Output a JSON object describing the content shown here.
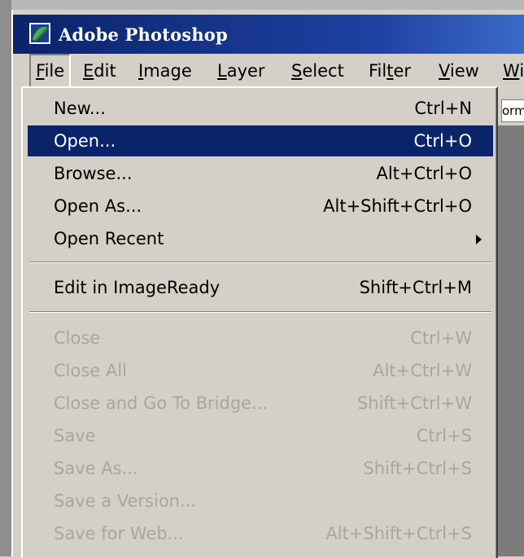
{
  "window": {
    "title": "Adobe Photoshop"
  },
  "menubar": {
    "items": [
      {
        "label": "File",
        "mnemonic": "F",
        "rest": "ile"
      },
      {
        "label": "Edit",
        "mnemonic": "E",
        "rest": "dit"
      },
      {
        "label": "Image",
        "mnemonic": "I",
        "rest": "mage"
      },
      {
        "label": "Layer",
        "mnemonic": "L",
        "rest": "ayer"
      },
      {
        "label": "Select",
        "mnemonic": "S",
        "rest": "elect"
      },
      {
        "label": "Filter",
        "pre": "Fil",
        "mnemonic": "t",
        "rest": "er"
      },
      {
        "label": "View",
        "mnemonic": "V",
        "rest": "iew"
      },
      {
        "label": "Wi",
        "mnemonic": "W",
        "rest": "i"
      }
    ]
  },
  "options_bar": {
    "partial_text": "orm"
  },
  "file_menu": {
    "items": [
      {
        "label": "New...",
        "shortcut": "Ctrl+N",
        "enabled": true
      },
      {
        "label": "Open...",
        "shortcut": "Ctrl+O",
        "enabled": true,
        "highlighted": true
      },
      {
        "label": "Browse...",
        "shortcut": "Alt+Ctrl+O",
        "enabled": true
      },
      {
        "label": "Open As...",
        "shortcut": "Alt+Shift+Ctrl+O",
        "enabled": true
      },
      {
        "label": "Open Recent",
        "shortcut": "",
        "enabled": true,
        "submenu": true
      },
      {
        "label": "Edit in ImageReady",
        "shortcut": "Shift+Ctrl+M",
        "enabled": true
      },
      {
        "label": "Close",
        "shortcut": "Ctrl+W",
        "enabled": false
      },
      {
        "label": "Close All",
        "shortcut": "Alt+Ctrl+W",
        "enabled": false
      },
      {
        "label": "Close and Go To Bridge...",
        "shortcut": "Shift+Ctrl+W",
        "enabled": false
      },
      {
        "label": "Save",
        "shortcut": "Ctrl+S",
        "enabled": false
      },
      {
        "label": "Save As...",
        "shortcut": "Shift+Ctrl+S",
        "enabled": false
      },
      {
        "label": "Save a Version...",
        "shortcut": "",
        "enabled": false
      },
      {
        "label": "Save for Web...",
        "shortcut": "Alt+Shift+Ctrl+S",
        "enabled": false
      }
    ]
  },
  "colors": {
    "highlight": "#0a246a",
    "menu_bg": "#d4d0c8",
    "disabled_text": "#a8a6a0"
  }
}
